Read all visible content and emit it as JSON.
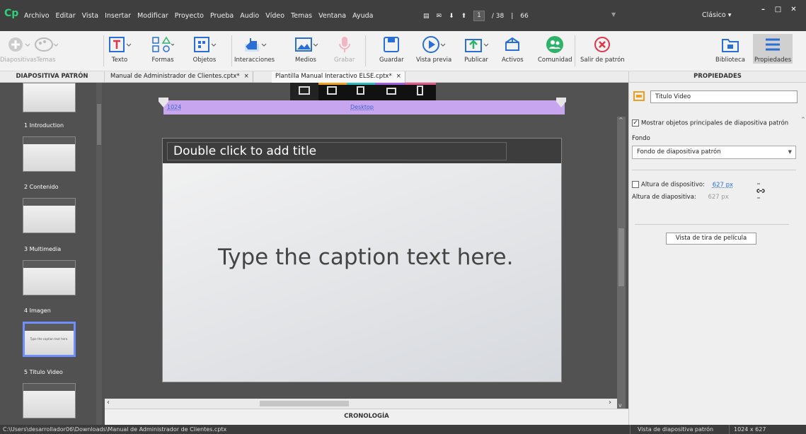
{
  "menubar": {
    "logo": "Cp",
    "items": [
      "Archivo",
      "Editar",
      "Vista",
      "Insertar",
      "Modificar",
      "Proyecto",
      "Prueba",
      "Audio",
      "Vídeo",
      "Temas",
      "Ventana",
      "Ayuda"
    ],
    "slide_current": "1",
    "slide_total": "/ 38",
    "zoom": "66",
    "workspace": "Clásico",
    "minimize": "–",
    "maximize": "□",
    "close": "✕"
  },
  "toolbar": {
    "diapositivas": "Diapositivas",
    "temas": "Temas",
    "texto": "Texto",
    "formas": "Formas",
    "objetos": "Objetos",
    "interacciones": "Interacciones",
    "medios": "Medios",
    "grabar": "Grabar",
    "guardar": "Guardar",
    "vista_previa": "Vista previa",
    "publicar": "Publicar",
    "activos": "Activos",
    "comunidad": "Comunidad",
    "salir_patron": "Salir de patrón",
    "biblioteca": "Biblioteca",
    "propiedades": "Propiedades"
  },
  "tabs": {
    "left_header": "DIAPOSITIVA PATRÓN",
    "doc1": "Manual de Administrador de Clientes.cptx*",
    "doc2": "Plantilla Manual Interactivo ELSE.cptx*",
    "close": "×",
    "right_header": "PROPIEDADES"
  },
  "slides": [
    {
      "label": "1 Introduction"
    },
    {
      "label": "2 Contenido"
    },
    {
      "label": "3 Multimedia"
    },
    {
      "label": "4 Imagen"
    },
    {
      "label": "5 Titulo Video",
      "thumb_text": "Type the caption text here."
    }
  ],
  "canvas": {
    "ruler_left": "1024",
    "ruler_center": "Desktop",
    "title_placeholder": "Double click to add title",
    "caption_placeholder": "Type the caption text here.",
    "timeline": "CRONOLOGÍA"
  },
  "properties": {
    "name": "Titulo Video",
    "show_master": "Mostrar objetos principales de diapositiva patrón",
    "fondo_label": "Fondo",
    "fondo_value": "Fondo de diapositiva patrón",
    "device_height_label": "Altura de dispositivo:",
    "device_height_value": "627 px",
    "slide_height_label": "Altura de diapositiva:",
    "slide_height_value": "627 px",
    "filmstrip_button": "Vista de tira de película"
  },
  "status": {
    "path": "C:\\Users\\desarrollador06\\Downloads\\Manual de Administrador de Clientes.cptx",
    "view": "Vista de diapositiva patrón",
    "size": "1024 x 627"
  },
  "colors": {
    "accent": "#6f8fff",
    "ruler": "#c7a6ef",
    "logo": "#2fd07a"
  }
}
